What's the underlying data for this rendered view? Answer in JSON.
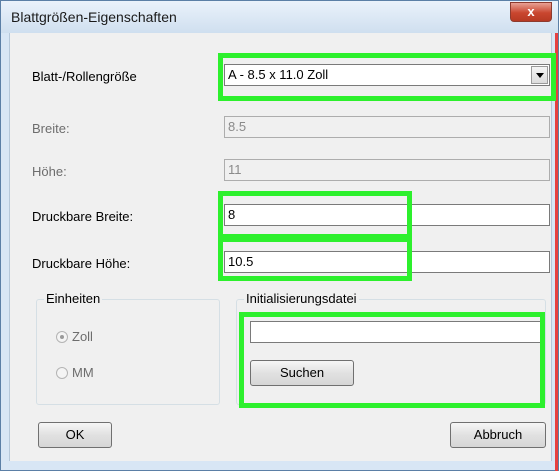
{
  "window": {
    "title": "Blattgrößen-Eigenschaften",
    "close_label": "x"
  },
  "paper_size": {
    "label": "Blatt-/Rollengröße",
    "value": "A - 8.5 x 11.0 Zoll"
  },
  "width": {
    "label": "Breite:",
    "value": "8.5"
  },
  "height": {
    "label": "Höhe:",
    "value": "11"
  },
  "printable_width": {
    "label": "Druckbare Breite:",
    "value": "8"
  },
  "printable_height": {
    "label": "Druckbare Höhe:",
    "value": "10.5"
  },
  "units": {
    "title": "Einheiten",
    "options": [
      {
        "label": "Zoll",
        "selected": true
      },
      {
        "label": "MM",
        "selected": false
      }
    ]
  },
  "init_file": {
    "title": "Initialisierungsdatei",
    "value": "",
    "browse_label": "Suchen"
  },
  "buttons": {
    "ok": "OK",
    "cancel": "Abbruch"
  },
  "colors": {
    "highlight": "#2df02d",
    "titlebar": "#d8e6f5",
    "close_button": "#c9462f"
  }
}
